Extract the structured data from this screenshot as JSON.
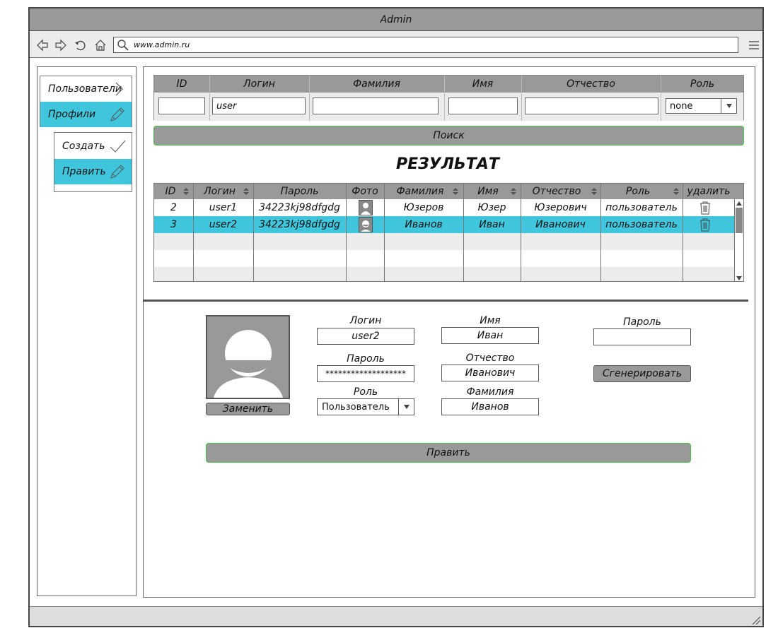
{
  "window": {
    "title": "Admin"
  },
  "browser": {
    "url": "www.admin.ru"
  },
  "sidebar": {
    "items": [
      {
        "label": "Пользователи",
        "icon": "chevron-right-icon"
      },
      {
        "label": "Профили",
        "icon": "pencil-icon",
        "selected": true
      }
    ],
    "subitems": [
      {
        "label": "Создать",
        "icon": "check-icon"
      },
      {
        "label": "Править",
        "icon": "pencil-icon",
        "selected": true
      }
    ]
  },
  "filter": {
    "headers": [
      "ID",
      "Логин",
      "Фамилия",
      "Имя",
      "Отчество",
      "Роль"
    ],
    "values": {
      "id": "",
      "login": "user",
      "surname": "",
      "name": "",
      "patronymic": "",
      "role": "none"
    }
  },
  "search_button": "Поиск",
  "result_title": "РЕЗУЛЬТАТ",
  "results": {
    "headers": [
      "ID",
      "Логин",
      "Пароль",
      "Фото",
      "Фамилия",
      "Имя",
      "Отчество",
      "Роль",
      "удалить"
    ],
    "rows": [
      {
        "id": "2",
        "login": "user1",
        "password": "34223kj98dfgdg",
        "surname": "Юзеров",
        "name": "Юзер",
        "patronymic": "Юзерович",
        "role": "пользователь",
        "selected": false
      },
      {
        "id": "3",
        "login": "user2",
        "password": "34223kj98dfgdg",
        "surname": "Иванов",
        "name": "Иван",
        "patronymic": "Иванович",
        "role": "пользователь",
        "selected": true
      }
    ]
  },
  "edit": {
    "replace_button": "Заменить",
    "login_label": "Логин",
    "login_value": "user2",
    "password_label": "Пароль",
    "password_value": "*******************",
    "role_label": "Роль",
    "role_value": "Пользователь",
    "name_label": "Имя",
    "name_value": "Иван",
    "patronymic_label": "Отчество",
    "patronymic_value": "Иванович",
    "surname_label": "Фамилия",
    "surname_value": "Иванов",
    "new_password_label": "Пароль",
    "new_password_value": "",
    "generate_button": "Сгенерировать",
    "submit_button": "Править"
  },
  "colors": {
    "accent": "#3fc6dc",
    "header_gray": "#999999",
    "button_border": "#47c447"
  }
}
